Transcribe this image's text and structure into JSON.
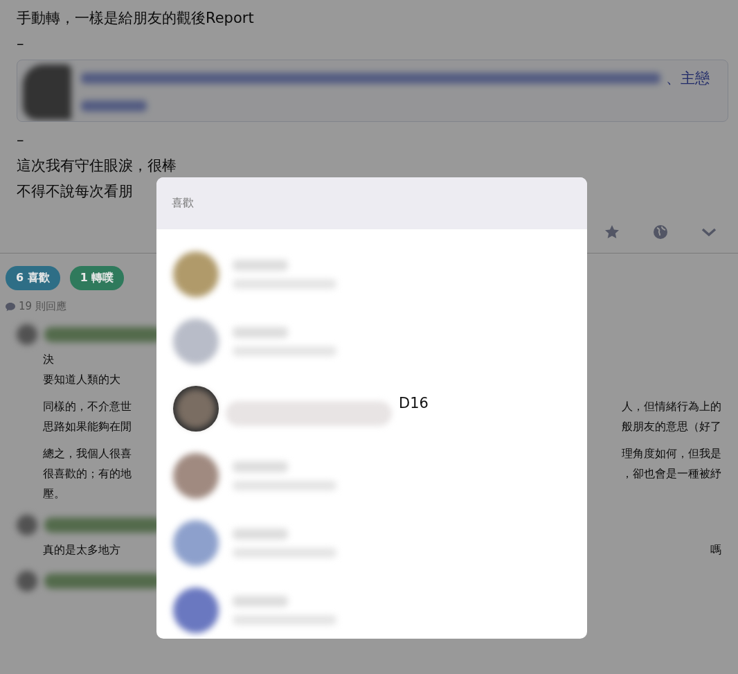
{
  "post": {
    "lines_before": [
      "手動轉，一樣是給朋友的觀後Report",
      "–"
    ],
    "link_card": {
      "visible_text": "、主戀"
    },
    "lines_after": [
      "–",
      "這次我有守住眼淚，很棒",
      "不得不說每次看朋"
    ]
  },
  "reactions": [
    {
      "label": "6 喜歡",
      "color": "#2e6e86"
    },
    {
      "label": "1 轉噗",
      "color": "#2f7a5c"
    }
  ],
  "reply_count": "19 則回應",
  "comments": [
    {
      "kind": "text",
      "paragraphs": [
        [
          {
            "left": "決"
          },
          {
            "left": "要知道人類的大"
          }
        ],
        [
          {
            "left": "同樣的，不介意世",
            "right": "人，但情緒行為上的"
          },
          {
            "left": "思路如果能夠在閒",
            "right": "般朋友的意思（好了"
          }
        ],
        [
          {
            "left": "總之，我個人很喜",
            "right": "理角度如何，但我是"
          },
          {
            "left": "很喜歡的；有的地",
            "right": "，卻也會是一種被紓"
          },
          {
            "left": "壓。"
          }
        ]
      ]
    },
    {
      "kind": "text",
      "paragraphs": [
        [
          {
            "left": "真的是太多地方",
            "right": "嗎"
          }
        ]
      ]
    },
    {
      "kind": "header_only"
    }
  ],
  "modal": {
    "title": "喜歡",
    "users": [
      {
        "kind": "blurred"
      },
      {
        "kind": "blurred"
      },
      {
        "kind": "named",
        "name": "D16"
      },
      {
        "kind": "blurred"
      },
      {
        "kind": "blurred"
      },
      {
        "kind": "blurred"
      }
    ]
  }
}
